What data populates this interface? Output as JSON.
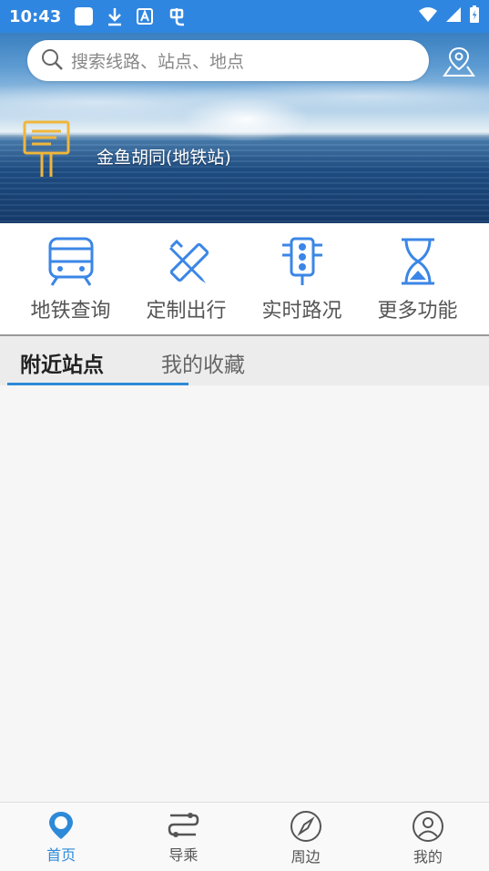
{
  "status_bar": {
    "time": "10:43"
  },
  "search": {
    "placeholder": "搜索线路、站点、地点"
  },
  "hero": {
    "station": "金鱼胡同(地铁站)"
  },
  "features": [
    {
      "label": "地铁查询",
      "icon": "train-icon"
    },
    {
      "label": "定制出行",
      "icon": "pencil-ruler-icon"
    },
    {
      "label": "实时路况",
      "icon": "traffic-light-icon"
    },
    {
      "label": "更多功能",
      "icon": "hourglass-icon"
    }
  ],
  "tabs": {
    "nearby": "附近站点",
    "favorites": "我的收藏"
  },
  "bottom_nav": [
    {
      "label": "首页",
      "icon": "location-pin-icon"
    },
    {
      "label": "导乘",
      "icon": "route-icon"
    },
    {
      "label": "周边",
      "icon": "compass-icon"
    },
    {
      "label": "我的",
      "icon": "user-icon"
    }
  ],
  "colors": {
    "accent": "#2d8ad8",
    "status_bar": "#2f86e0",
    "icon_blue": "#3b86e6"
  }
}
